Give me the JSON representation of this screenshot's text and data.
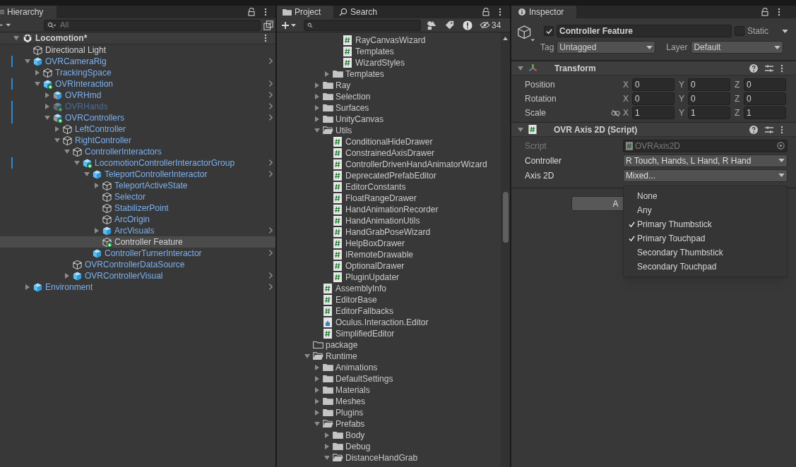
{
  "hierarchy": {
    "tab": "Hierarchy",
    "search_placeholder": "All",
    "scene": {
      "label": "Locomotion*",
      "expanded": true
    },
    "items": [
      {
        "label": "Directional Light",
        "kind": "object",
        "added": false,
        "prefab": false,
        "root": false,
        "override": false,
        "active": true,
        "selected": false
      },
      {
        "label": "OVRCameraRig",
        "kind": "prefab",
        "added": false,
        "expanded": true,
        "prefab": true,
        "root": true,
        "override": true,
        "active": true,
        "selected": false,
        "children": [
          {
            "label": "TrackingSpace",
            "kind": "object",
            "added": false,
            "expanded": false,
            "prefab": true,
            "root": false,
            "override": false,
            "active": true,
            "selected": false
          },
          {
            "label": "OVRInteraction",
            "kind": "prefab",
            "added": true,
            "expanded": true,
            "prefab": true,
            "root": true,
            "override": true,
            "active": true,
            "selected": false,
            "children": [
              {
                "label": "OVRHmd",
                "kind": "model",
                "added": false,
                "expanded": false,
                "prefab": true,
                "root": true,
                "override": false,
                "active": true,
                "selected": false
              },
              {
                "label": "OVRHands",
                "kind": "model",
                "added": true,
                "expanded": false,
                "prefab": true,
                "root": true,
                "override": true,
                "active": false,
                "selected": false
              },
              {
                "label": "OVRControllers",
                "kind": "model",
                "added": true,
                "expanded": true,
                "prefab": true,
                "root": true,
                "override": true,
                "active": true,
                "selected": false,
                "children": [
                  {
                    "label": "LeftController",
                    "kind": "object",
                    "added": false,
                    "expanded": false,
                    "prefab": true,
                    "root": false,
                    "override": false,
                    "active": true,
                    "selected": false
                  },
                  {
                    "label": "RightController",
                    "kind": "object",
                    "added": false,
                    "expanded": true,
                    "prefab": true,
                    "root": false,
                    "override": false,
                    "active": true,
                    "selected": false,
                    "children": [
                      {
                        "label": "ControllerInteractors",
                        "kind": "object",
                        "added": false,
                        "expanded": true,
                        "prefab": true,
                        "root": false,
                        "override": false,
                        "active": true,
                        "selected": false,
                        "children": [
                          {
                            "label": "LocomotionControllerInteractorGroup",
                            "kind": "prefab",
                            "added": true,
                            "expanded": true,
                            "prefab": true,
                            "root": true,
                            "override": true,
                            "active": true,
                            "selected": false,
                            "children": [
                              {
                                "label": "TeleportControllerInteractor",
                                "kind": "prefab",
                                "added": false,
                                "expanded": true,
                                "prefab": true,
                                "root": true,
                                "override": false,
                                "active": true,
                                "selected": false,
                                "children": [
                                  {
                                    "label": "TeleportActiveState",
                                    "kind": "object",
                                    "added": false,
                                    "expanded": false,
                                    "prefab": true,
                                    "root": false,
                                    "override": false,
                                    "active": true,
                                    "selected": false
                                  },
                                  {
                                    "label": "Selector",
                                    "kind": "object",
                                    "added": false,
                                    "prefab": true,
                                    "root": false,
                                    "override": false,
                                    "active": true,
                                    "selected": false
                                  },
                                  {
                                    "label": "StabilizerPoint",
                                    "kind": "object",
                                    "added": false,
                                    "prefab": true,
                                    "root": false,
                                    "override": false,
                                    "active": true,
                                    "selected": false
                                  },
                                  {
                                    "label": "ArcOrigin",
                                    "kind": "object",
                                    "added": false,
                                    "prefab": true,
                                    "root": false,
                                    "override": false,
                                    "active": true,
                                    "selected": false
                                  },
                                  {
                                    "label": "ArcVisuals",
                                    "kind": "prefab",
                                    "added": false,
                                    "expanded": false,
                                    "prefab": true,
                                    "root": true,
                                    "override": false,
                                    "active": true,
                                    "selected": false
                                  },
                                  {
                                    "label": "Controller Feature",
                                    "kind": "object",
                                    "added": true,
                                    "prefab": false,
                                    "root": false,
                                    "override": false,
                                    "active": true,
                                    "selected": true
                                  }
                                ]
                              },
                              {
                                "label": "ControllerTurnerInteractor",
                                "kind": "prefab",
                                "added": false,
                                "prefab": true,
                                "root": true,
                                "override": false,
                                "active": true,
                                "selected": false
                              }
                            ]
                          }
                        ]
                      },
                      {
                        "label": "OVRControllerDataSource",
                        "kind": "object",
                        "added": false,
                        "prefab": true,
                        "root": false,
                        "override": false,
                        "active": true,
                        "selected": false
                      },
                      {
                        "label": "OVRControllerVisual",
                        "kind": "prefab",
                        "added": false,
                        "expanded": false,
                        "prefab": true,
                        "root": true,
                        "override": false,
                        "active": true,
                        "selected": false
                      }
                    ]
                  }
                ]
              }
            ]
          }
        ]
      },
      {
        "label": "Environment",
        "kind": "prefab",
        "added": false,
        "expanded": false,
        "prefab": true,
        "root": true,
        "override": false,
        "active": true,
        "selected": false
      }
    ]
  },
  "project": {
    "tabs": [
      {
        "label": "Project",
        "selected": true
      },
      {
        "label": "Search",
        "selected": false
      }
    ],
    "hidden_count": "34",
    "items": [
      {
        "children": [
          {
            "children": [
              {
                "children": [
                  {
                    "label": "RayCanvasWizard",
                    "kind": "script"
                  },
                  {
                    "label": "Templates",
                    "kind": "script"
                  },
                  {
                    "label": "WizardStyles",
                    "kind": "script"
                  }
                ]
              },
              {
                "label": "Templates",
                "kind": "folder",
                "expanded": false
              }
            ]
          },
          {
            "label": "Ray",
            "kind": "folder",
            "expanded": false
          },
          {
            "label": "Selection",
            "kind": "folder",
            "expanded": false
          },
          {
            "label": "Surfaces",
            "kind": "folder",
            "expanded": false
          },
          {
            "label": "UnityCanvas",
            "kind": "folder",
            "expanded": false
          },
          {
            "label": "Utils",
            "kind": "folder",
            "expanded": true,
            "children": [
              {
                "label": "ConditionalHideDrawer",
                "kind": "script"
              },
              {
                "label": "ConstrainedAxisDrawer",
                "kind": "script"
              },
              {
                "label": "ControllerDrivenHandAnimatorWizard",
                "kind": "script"
              },
              {
                "label": "DeprecatedPrefabEditor",
                "kind": "script"
              },
              {
                "label": "EditorConstants",
                "kind": "script"
              },
              {
                "label": "FloatRangeDrawer",
                "kind": "script"
              },
              {
                "label": "HandAnimationRecorder",
                "kind": "script"
              },
              {
                "label": "HandAnimationUtils",
                "kind": "script"
              },
              {
                "label": "HandGrabPoseWizard",
                "kind": "script"
              },
              {
                "label": "HelpBoxDrawer",
                "kind": "script"
              },
              {
                "label": "IRemoteDrawable",
                "kind": "script"
              },
              {
                "label": "OptionalDrawer",
                "kind": "script"
              },
              {
                "label": "PluginUpdater",
                "kind": "script"
              }
            ]
          },
          {
            "label": "AssemblyInfo",
            "kind": "script"
          },
          {
            "label": "EditorBase",
            "kind": "script"
          },
          {
            "label": "EditorFallbacks",
            "kind": "script"
          },
          {
            "label": "Oculus.Interaction.Editor",
            "kind": "assembly"
          },
          {
            "label": "SimplifiedEditor",
            "kind": "script"
          }
        ]
      },
      {
        "label": "package",
        "kind": "folder"
      },
      {
        "label": "Runtime",
        "kind": "folder",
        "expanded": true,
        "children": [
          {
            "label": "Animations",
            "kind": "folder",
            "expanded": false
          },
          {
            "label": "DefaultSettings",
            "kind": "folder",
            "expanded": false
          },
          {
            "label": "Materials",
            "kind": "folder",
            "expanded": false
          },
          {
            "label": "Meshes",
            "kind": "folder",
            "expanded": false
          },
          {
            "label": "Plugins",
            "kind": "folder",
            "expanded": false
          },
          {
            "label": "Prefabs",
            "kind": "folder",
            "expanded": true,
            "children": [
              {
                "label": "Body",
                "kind": "folder",
                "expanded": false
              },
              {
                "label": "Debug",
                "kind": "folder",
                "expanded": false
              },
              {
                "label": "DistanceHandGrab",
                "kind": "folder",
                "expanded": true
              }
            ]
          }
        ]
      }
    ]
  },
  "inspector": {
    "tab": "Inspector",
    "active": true,
    "name": "Controller Feature",
    "static": false,
    "static_label": "Static",
    "tag_label": "Tag",
    "tag": "Untagged",
    "layer_label": "Layer",
    "layer": "Default",
    "components": [
      {
        "kind": "transform",
        "title": "Transform",
        "expanded": true,
        "rows": [
          {
            "label": "Position",
            "proportions_toggle": false,
            "values": [
              {
                "axis": "X",
                "value": "0"
              },
              {
                "axis": "Y",
                "value": "0"
              },
              {
                "axis": "Z",
                "value": "0"
              }
            ]
          },
          {
            "label": "Rotation",
            "proportions_toggle": false,
            "values": [
              {
                "axis": "X",
                "value": "0"
              },
              {
                "axis": "Y",
                "value": "0"
              },
              {
                "axis": "Z",
                "value": "0"
              }
            ]
          },
          {
            "label": "Scale",
            "proportions_toggle": true,
            "values": [
              {
                "axis": "X",
                "value": "1"
              },
              {
                "axis": "Y",
                "value": "1"
              },
              {
                "axis": "Z",
                "value": "1"
              }
            ]
          }
        ]
      },
      {
        "kind": "script",
        "title": "OVR Axis 2D (Script)",
        "expanded": true,
        "fields": [
          {
            "label": "Script",
            "kind": "object",
            "value": "OVRAxis2D",
            "disabled": true
          },
          {
            "label": "Controller",
            "kind": "dropdown",
            "value": "R Touch, Hands, L Hand, R Hand",
            "disabled": false
          },
          {
            "label": "Axis 2D",
            "kind": "dropdown",
            "value": "Mixed...",
            "disabled": false
          }
        ]
      }
    ],
    "add_button": "A",
    "popup": [
      {
        "label": "None",
        "checked": false
      },
      {
        "label": "Any",
        "checked": false
      },
      {
        "label": "Primary Thumbstick",
        "checked": true
      },
      {
        "label": "Primary Touchpad",
        "checked": true
      },
      {
        "label": "Secondary Thumbstick",
        "checked": false
      },
      {
        "label": "Secondary Touchpad",
        "checked": false
      }
    ]
  }
}
